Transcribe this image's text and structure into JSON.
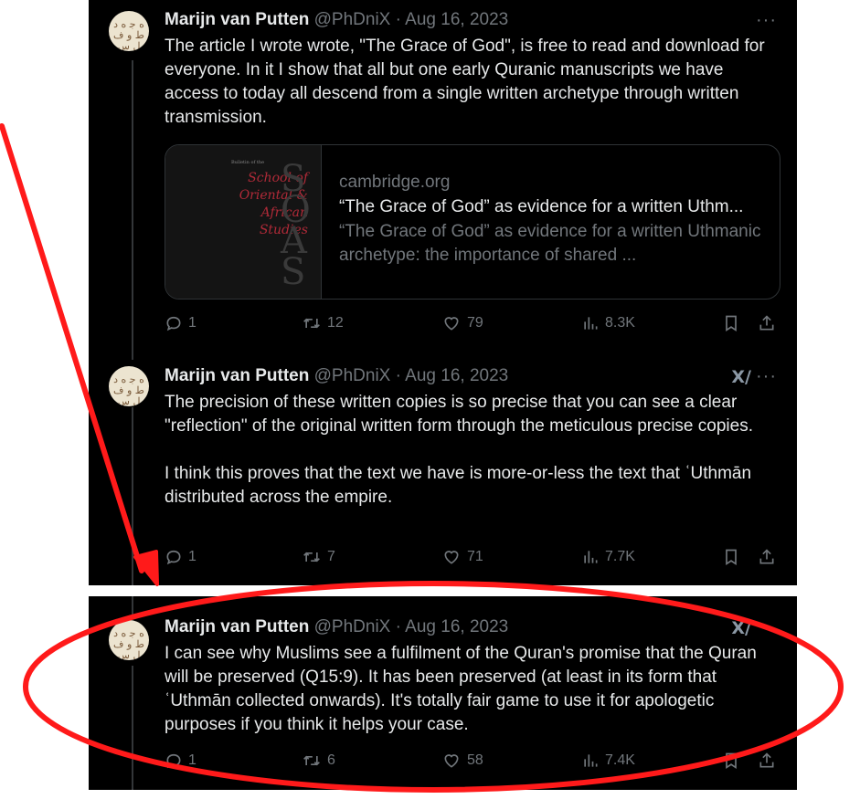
{
  "tweets": [
    {
      "author": "Marijn van Putten",
      "handle": "@PhDniX · Aug 16, 2023",
      "avatar_text": "ﻩ ﺟ ﻩ ﺩ ﻁ ﻭ ﻑ ﻝ ﺱ",
      "more": "···",
      "text": "The article I wrote wrote, \"The Grace of God\", is free to read and download for everyone. In it I show that all but one early Quranic manuscripts we have access to today all descend from a single written archetype through written transmission.",
      "card": {
        "bulletin": "Bulletin of the",
        "journal": "School of Oriental & African Studies",
        "logo": "SOAS",
        "domain": "cambridge.org",
        "title": "“The Grace of God” as evidence for a written Uthm...",
        "desc": "“The Grace of God” as evidence for a written Uthmanic archetype: the importance of shared ..."
      },
      "reply": "1",
      "retweet": "12",
      "like": "79",
      "views": "8.3K"
    },
    {
      "author": "Marijn van Putten",
      "handle": "@PhDniX · Aug 16, 2023",
      "avatar_text": "ﻩ ﺟ ﻩ ﺩ ﻁ ﻭ ﻑ ﻝ ﺱ",
      "grok": "X/",
      "more": "···",
      "text": "The precision of these written copies is so precise that you can see a clear \"reflection\" of the original written form through the meticulous precise copies.\n\nI think this proves that the text we have is more-or-less the text that ʿUthmān distributed across the empire.",
      "reply": "1",
      "retweet": "7",
      "like": "71",
      "views": "7.7K"
    },
    {
      "author": "Marijn van Putten",
      "handle": "@PhDniX · Aug 16, 2023",
      "avatar_text": "ﻩ ﺟ ﻩ ﺩ ﻁ ﻭ ﻑ ﻝ ﺱ",
      "grok": "X/",
      "text": "I can see why Muslims see a fulfilment of the Quran's promise that the Quran will be preserved (Q15:9). It has been preserved (at least in its form that ʿUthmān collected onwards). It's totally fair game to use it for apologetic purposes if you think it helps your case.",
      "reply": "1",
      "retweet": "6",
      "like": "58",
      "views": "7.4K"
    }
  ],
  "colors": {
    "background": "#000000",
    "text": "#e7e9ea",
    "muted": "#71767b",
    "annotation_red": "#ff1a1a"
  }
}
